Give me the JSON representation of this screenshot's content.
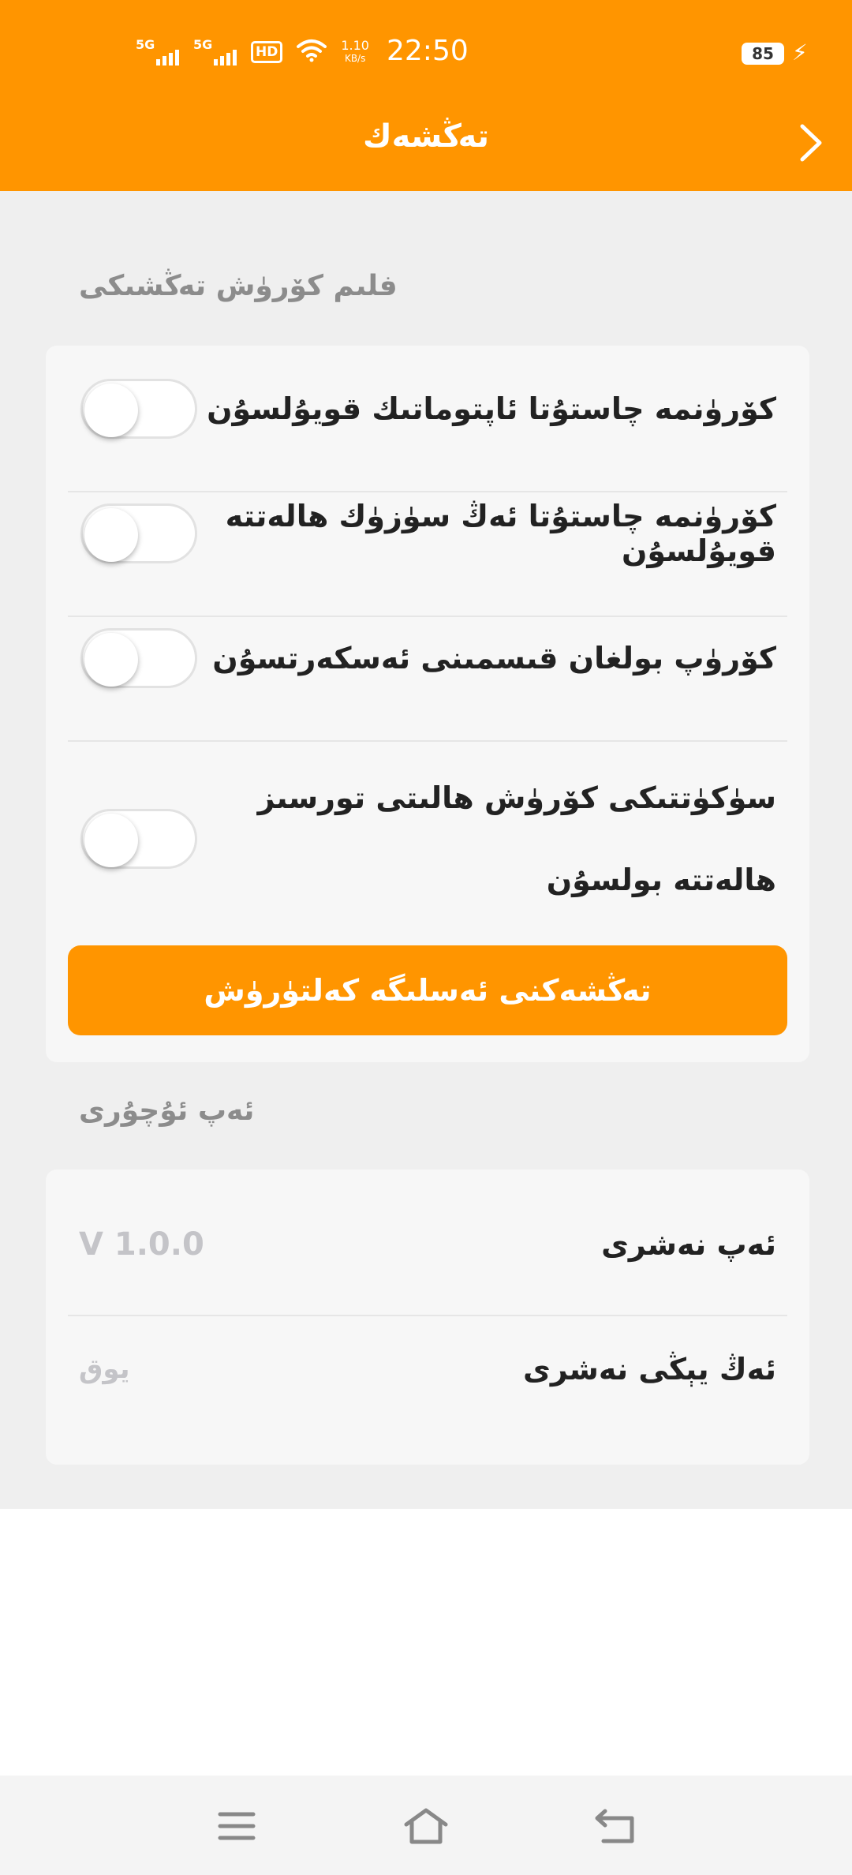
{
  "status_bar": {
    "signal_1": "5G",
    "signal_2": "5G",
    "hd_badge": "HD",
    "speed_value": "1.10",
    "speed_unit": "KB/s",
    "time": "22:50",
    "battery": "85"
  },
  "header": {
    "title": "تەڭشەك"
  },
  "film_settings": {
    "section_title": "فلىم كۆرۈش تەڭشىكى",
    "items": [
      {
        "label": "كۆرۈنمە چاستۇتا ئاپتوماتىك قويۇلسۇن",
        "enabled": false
      },
      {
        "label": "كۆرۈنمە چاستۇتا ئەڭ سۈزۈك ھالەتتە قويۇلسۇن",
        "enabled": false
      },
      {
        "label": "كۆرۈپ بولغان قىسمىنى ئەسكەرتسۇن",
        "enabled": false
      },
      {
        "label": "سۈكۈتتىكى كۆرۈش ھالىتى تورسىز ھالەتتە بولسۇن",
        "enabled": false
      }
    ],
    "reset_button": "تەڭشەكنى ئەسلىگە كەلتۈرۈش"
  },
  "app_info": {
    "section_title": "ئەپ ئۇچۇرى",
    "version_label": "ئەپ نەشرى",
    "version_value": "V 1.0.0",
    "latest_label": "ئەڭ يېڭى نەشرى",
    "latest_value": "يوق"
  },
  "nav": {
    "menu_icon": "menu-icon",
    "home_icon": "home-icon",
    "back_icon": "back-icon"
  },
  "colors": {
    "accent": "#ff9500",
    "background": "#efefef",
    "card": "#f7f7f7"
  }
}
